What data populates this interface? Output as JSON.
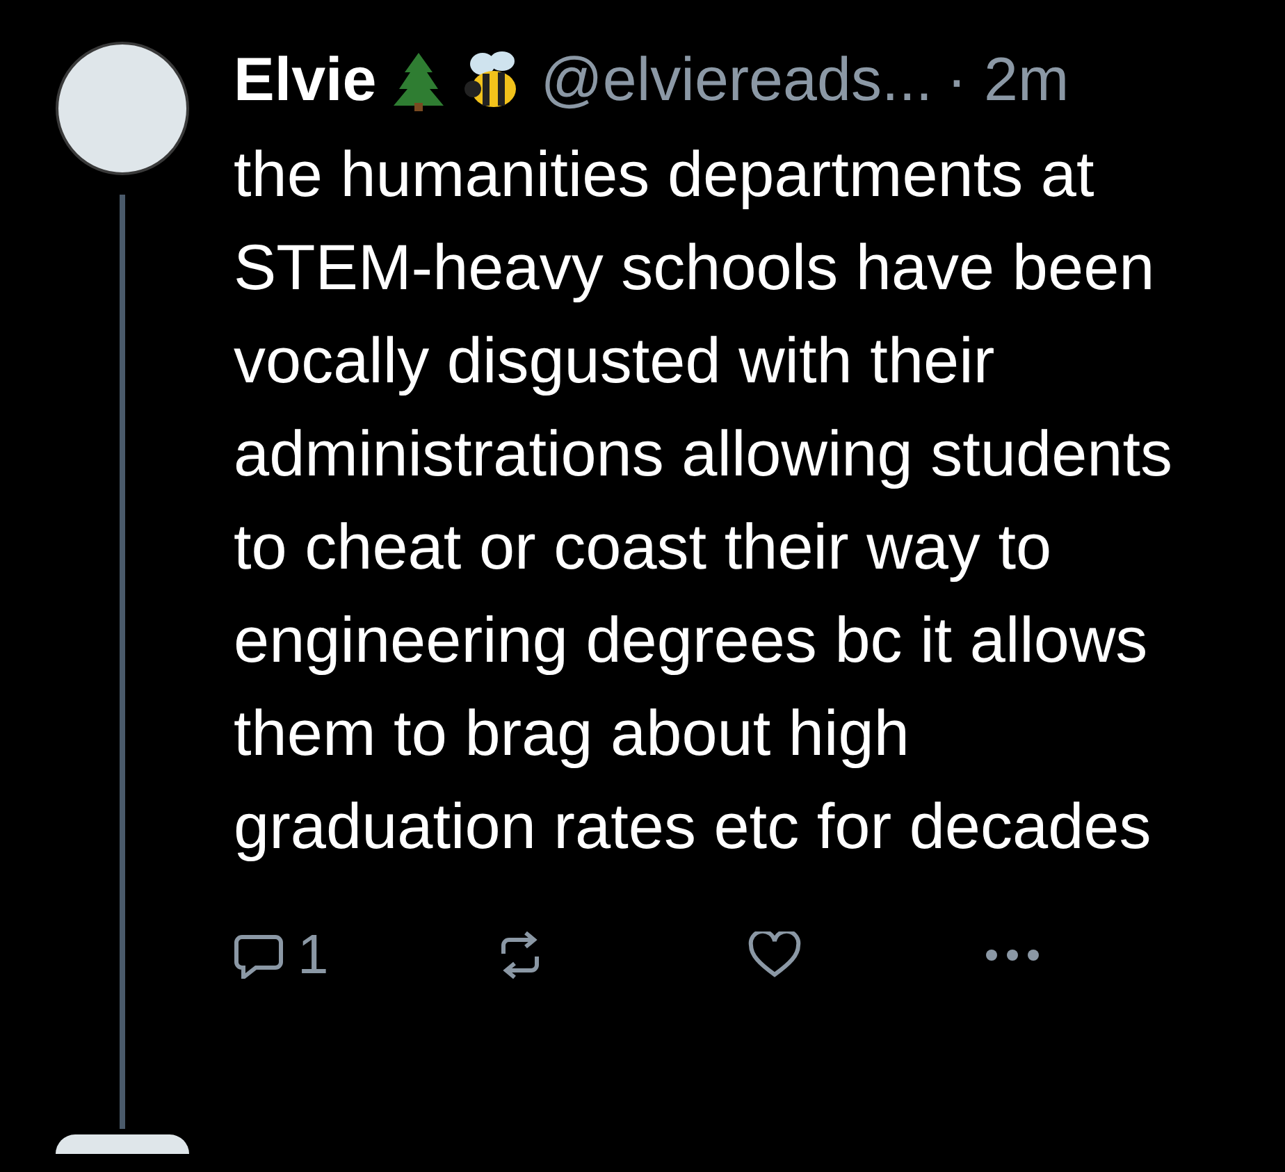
{
  "tweets": [
    {
      "name": "Elvie",
      "handle": "@elviereads...",
      "time": "· 2m",
      "text": "the humanities departments at STEM-heavy schools have been vocally disgusted with their administrations allowing students to cheat or coast their way to engineering degrees bc it allows them to brag about high graduation rates etc for decades",
      "reply_count": "1",
      "liked": false,
      "thread_line": true
    },
    {
      "partial": true
    }
  ]
}
